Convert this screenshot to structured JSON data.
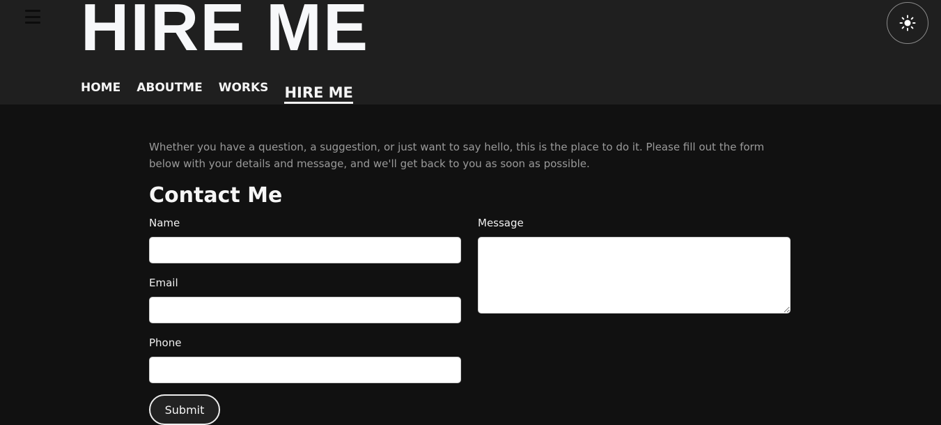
{
  "header": {
    "title": "HIRE ME",
    "menu_icon": "hamburger-menu-icon",
    "theme_toggle_icon": "sun-icon"
  },
  "nav": {
    "items": [
      {
        "label": "HOME",
        "active": false
      },
      {
        "label": "ABOUTME",
        "active": false
      },
      {
        "label": "WORKS",
        "active": false
      },
      {
        "label": "HIRE ME",
        "active": true
      }
    ]
  },
  "main": {
    "intro": "Whether you have a question, a suggestion, or just want to say hello, this is the place to do it. Please fill out the form below with your details and message, and we'll get back to you as soon as possible.",
    "heading": "Contact Me",
    "form": {
      "name_label": "Name",
      "name_value": "",
      "email_label": "Email",
      "email_value": "",
      "phone_label": "Phone",
      "phone_value": "",
      "message_label": "Message",
      "message_value": "",
      "submit_label": "Submit"
    }
  },
  "colors": {
    "header_bg": "#1f1f1f",
    "page_bg": "#111111",
    "text": "#f5f5f5",
    "muted_text": "#9a9a9a"
  }
}
